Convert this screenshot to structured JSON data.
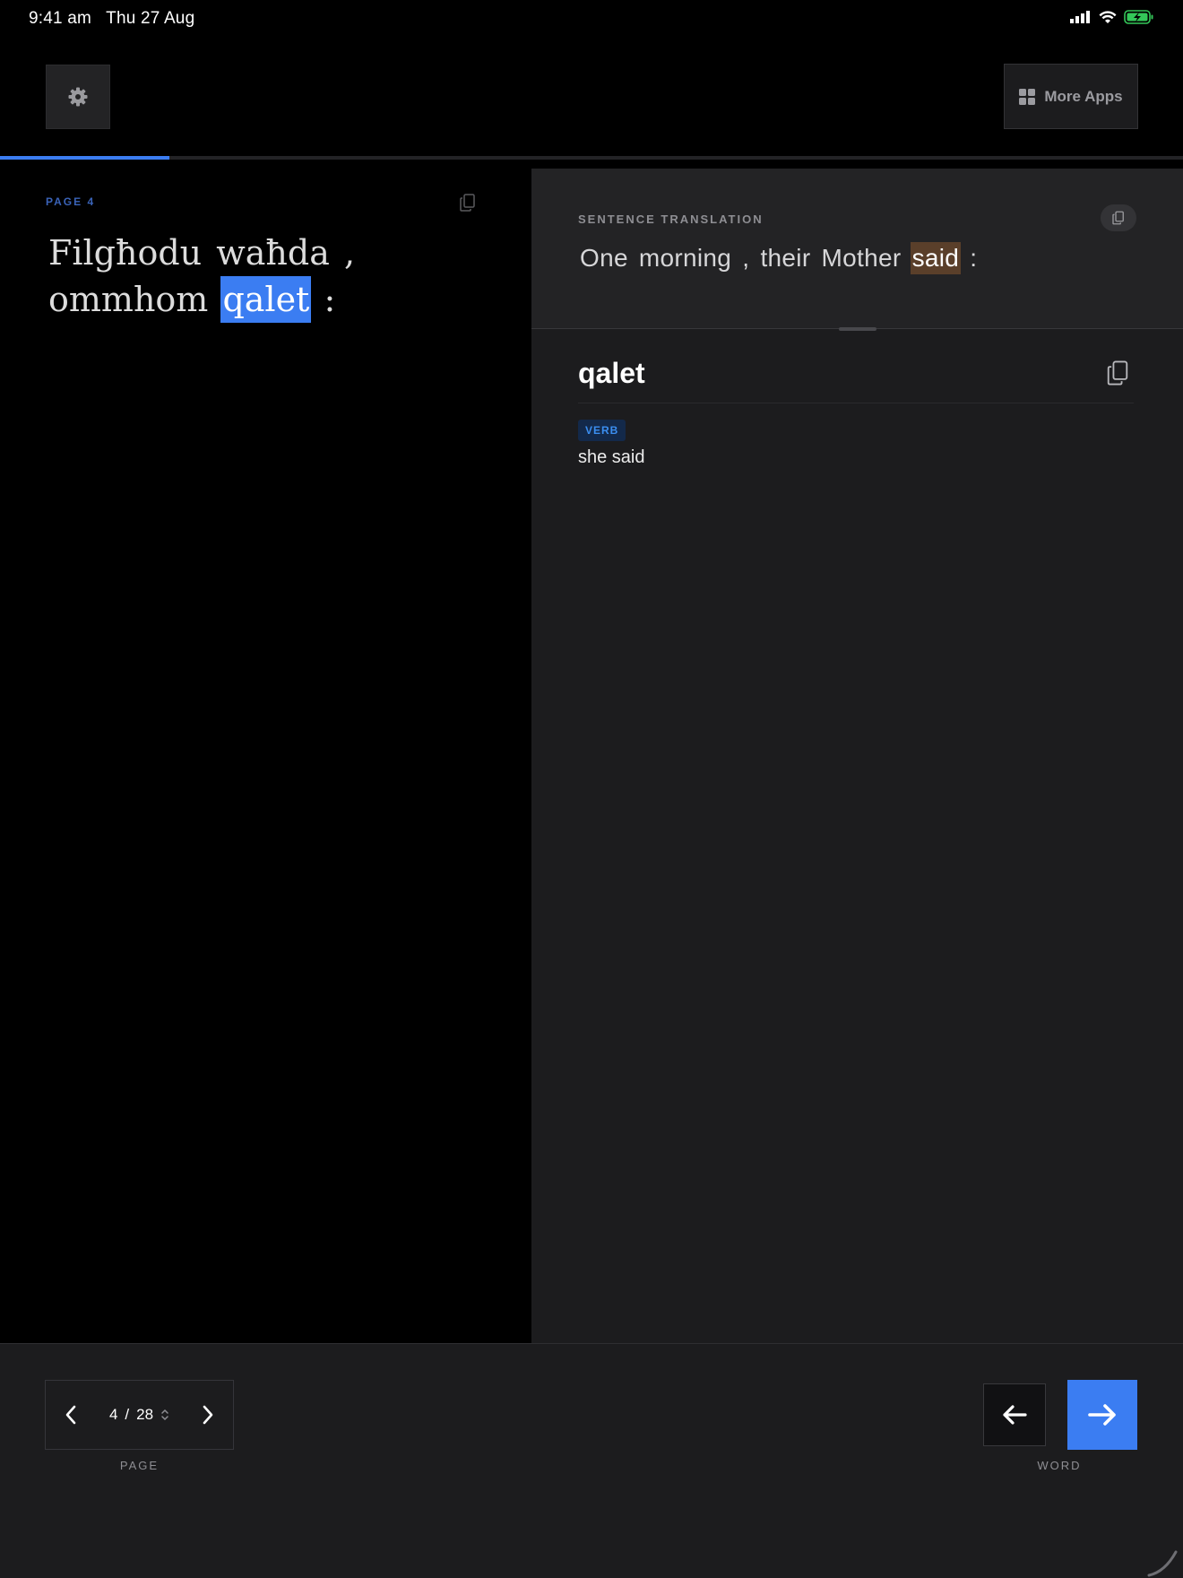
{
  "status_bar": {
    "time": "9:41 am",
    "date": "Thu 27 Aug",
    "icons": [
      "signal-icon",
      "wifi-icon",
      "battery-charging-icon"
    ]
  },
  "header": {
    "settings_icon": "gear-icon",
    "more_apps_label": "More Apps",
    "more_apps_icon": "grid-icon"
  },
  "progress": {
    "fraction": 0.143,
    "color": "#3b7df2"
  },
  "source": {
    "page_label": "PAGE  4",
    "line1": [
      {
        "text": "Filgħodu"
      },
      {
        "text": "waħda"
      },
      {
        "text": ","
      }
    ],
    "line2": [
      {
        "text": "ommhom"
      },
      {
        "text": "qalet",
        "active": true
      },
      {
        "text": ":"
      }
    ]
  },
  "translation": {
    "label": "SENTENCE TRANSLATION",
    "words": [
      {
        "text": "One"
      },
      {
        "text": "morning"
      },
      {
        "text": ","
      },
      {
        "text": "their"
      },
      {
        "text": "Mother"
      },
      {
        "text": "said",
        "active": true
      },
      {
        "text": ":"
      }
    ]
  },
  "word_detail": {
    "word": "qalet",
    "pos": "VERB",
    "definition": "she said"
  },
  "bottom": {
    "page_current": "4",
    "page_separator": "/",
    "page_total": "28",
    "page_caption": "PAGE",
    "word_caption": "WORD"
  },
  "colors": {
    "accent": "#3b7df2",
    "highlight_translation": "#5a3f2a",
    "panel": "#1c1c1e"
  }
}
